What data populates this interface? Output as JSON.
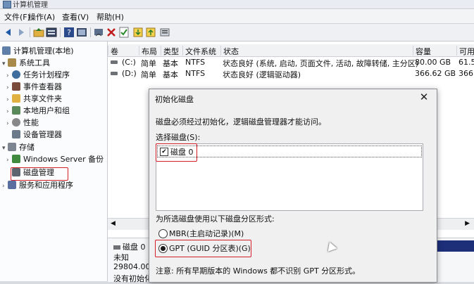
{
  "window": {
    "title": "计算机管理"
  },
  "menu": [
    "文件(F)",
    "操作(A)",
    "查看(V)",
    "帮助(H)"
  ],
  "toolbar": {
    "icons": [
      "back-icon",
      "forward-icon",
      "up-folder-icon",
      "properties-icon",
      "help-icon",
      "console-icon",
      "delete-icon",
      "checklist-icon",
      "import-icon",
      "export-icon"
    ]
  },
  "tree": {
    "items": [
      {
        "label": "计算机管理(本地)",
        "icon": "computer"
      },
      {
        "label": "系统工具",
        "icon": "tools"
      },
      {
        "label": "任务计划程序",
        "icon": "clock"
      },
      {
        "label": "事件查看器",
        "icon": "event"
      },
      {
        "label": "共享文件夹",
        "icon": "folder"
      },
      {
        "label": "本地用户和组",
        "icon": "users"
      },
      {
        "label": "性能",
        "icon": "perf"
      },
      {
        "label": "设备管理器",
        "icon": "device"
      },
      {
        "label": "存储",
        "icon": "storage"
      },
      {
        "label": "Windows Server 备份",
        "icon": "backup"
      },
      {
        "label": "磁盘管理",
        "icon": "disk"
      },
      {
        "label": "服务和应用程序",
        "icon": "services"
      }
    ]
  },
  "volumes": {
    "headers": [
      "卷",
      "布局",
      "类型",
      "文件系统",
      "状态",
      "容量",
      "可用"
    ],
    "rows": [
      {
        "vol": "(C:)",
        "layout": "简单",
        "type": "基本",
        "fs": "NTFS",
        "status": "状态良好 (系统, 启动, 页面文件, 活动, 故障转储, 主分区)",
        "capacity": "80.00 GB",
        "free": "61.5"
      },
      {
        "vol": "(D:)",
        "layout": "简单",
        "type": "基本",
        "fs": "NTFS",
        "status": "状态良好 (逻辑驱动器)",
        "capacity": "366.62 GB",
        "free": "366."
      }
    ]
  },
  "lower": {
    "disk_name": "磁盘 0",
    "status": "未知",
    "size": "29804.00",
    "init": "没有初始化"
  },
  "dialog": {
    "title": "初始化磁盘",
    "message": "磁盘必须经过初始化，逻辑磁盘管理器才能访问。",
    "select_label": "选择磁盘(S):",
    "disk_item": "磁盘 0",
    "partition_label": "为所选磁盘使用以下磁盘分区形式:",
    "mbr_option": "MBR(主启动记录)(M)",
    "gpt_option": "GPT (GUID 分区表)(G)",
    "note": "注意: 所有早期版本的 Windows 都不识别 GPT 分区形式。",
    "selected": "GPT",
    "disk_checked": true
  },
  "colors": {
    "highlight": "#d21f2a",
    "stripe": "#1e2f7a"
  }
}
